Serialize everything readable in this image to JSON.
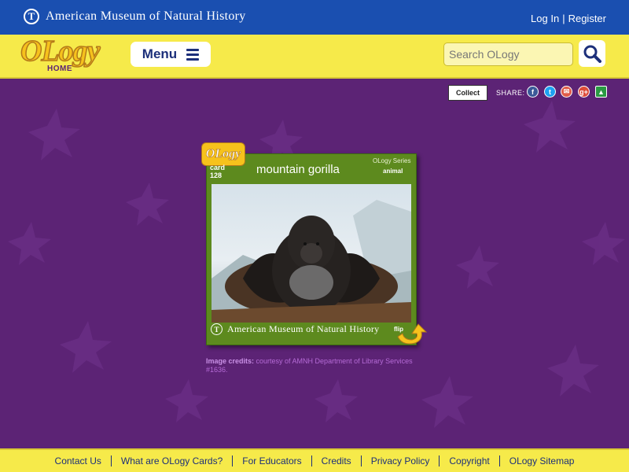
{
  "header": {
    "brand": "American Museum of Natural History",
    "login": "Log In",
    "register": "Register",
    "separator": "|"
  },
  "nav": {
    "logo_text": "OLogy",
    "logo_sub": "HOME",
    "menu_label": "Menu",
    "search_placeholder": "Search OLogy"
  },
  "share": {
    "collect_label": "Collect",
    "share_label": "SHARE:",
    "icons": [
      "facebook-icon",
      "twitter-icon",
      "email-icon",
      "google-plus-icon",
      "google-classroom-icon"
    ]
  },
  "card": {
    "badge": "OLogy",
    "card_word": "card",
    "card_number": "128",
    "title": "mountain gorilla",
    "series": "OLogy Series",
    "type": "animal",
    "footer_brand": "American Museum of Natural History",
    "flip_label": "flip"
  },
  "credits": {
    "label": "Image credits:",
    "text": " courtesy of AMNH Department of Library Services #1636."
  },
  "footer": {
    "links": [
      "Contact Us",
      "What are OLogy Cards?",
      "For Educators",
      "Credits",
      "Privacy Policy",
      "Copyright",
      "OLogy Sitemap"
    ]
  },
  "colors": {
    "header_blue": "#1a4fb0",
    "nav_yellow": "#f6ea4a",
    "page_purple": "#5c2375",
    "card_green": "#5d8a1e"
  }
}
